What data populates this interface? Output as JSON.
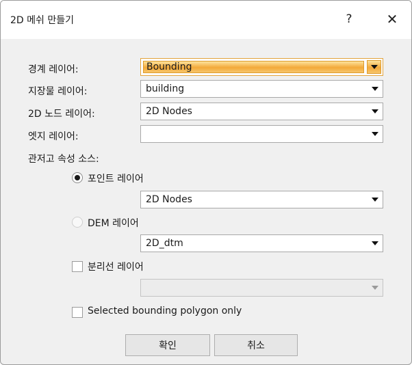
{
  "window": {
    "title": "2D 메쉬 만들기",
    "help_label": "?",
    "close_label": "✕"
  },
  "fields": {
    "boundary": {
      "label": "경계 레이어:",
      "value": "Bounding"
    },
    "feature": {
      "label": "지장물 레이어:",
      "value": "building"
    },
    "nodes": {
      "label": "2D 노드 레이어:",
      "value": "2D Nodes"
    },
    "edge": {
      "label": "엣지 레이어:",
      "value": ""
    }
  },
  "elevation": {
    "section_label": "관저고 속성 소스:",
    "point_layer": {
      "label": "포인트 레이어",
      "selected": true,
      "value": "2D Nodes"
    },
    "dem_layer": {
      "label": "DEM 레이어",
      "selected": false,
      "value": "2D_dtm"
    }
  },
  "breakline": {
    "label": "분리선 레이어",
    "checked": false,
    "value": ""
  },
  "selected_only": {
    "label": "Selected bounding polygon only",
    "checked": false
  },
  "buttons": {
    "ok": "확인",
    "cancel": "취소"
  },
  "icons": {
    "dropdown": "chevron-down-icon",
    "help": "question-mark-icon",
    "close": "close-icon"
  },
  "colors": {
    "focus_highlight": "#f3a93a",
    "dialog_bg": "#f0f0f0",
    "titlebar_bg": "#ffffff"
  }
}
